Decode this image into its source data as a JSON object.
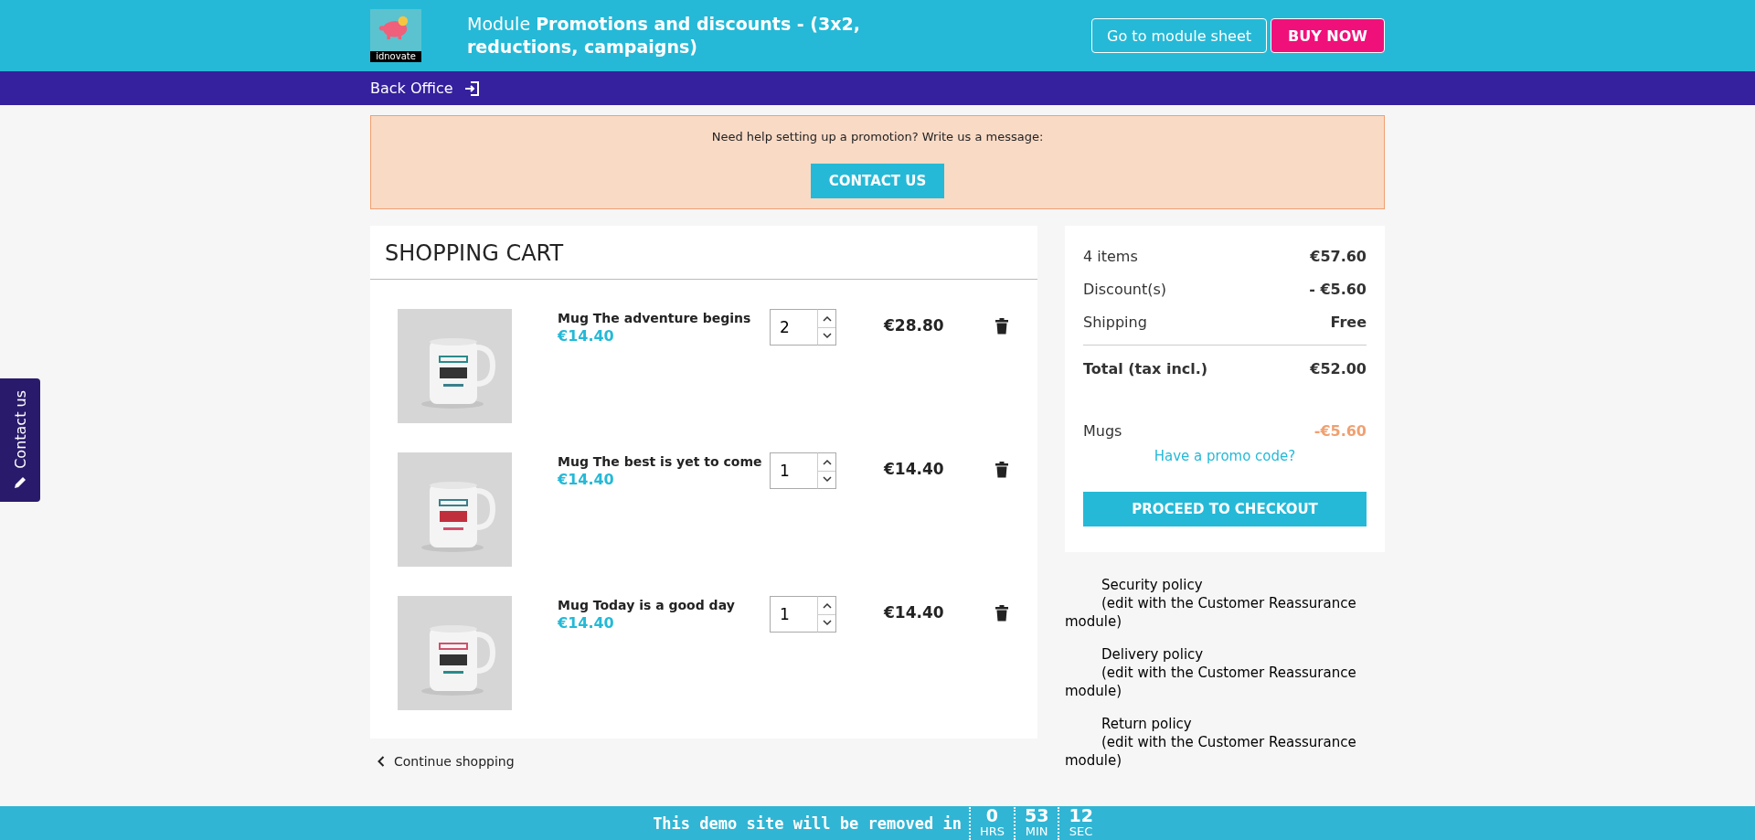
{
  "header": {
    "logo_text": "idnovate",
    "title": "Module **Promotions and discounts - (3x2, reductions, campaigns)**",
    "buttons": [
      {
        "label": "Go to module sheet",
        "kind": "outline"
      },
      {
        "label": "BUY NOW",
        "kind": "primary"
      }
    ]
  },
  "nav": {
    "link": "Back Office"
  },
  "help": {
    "text": "Need help setting up a promotion? Write us a message:",
    "button": "CONTACT US"
  },
  "cart": {
    "title": "SHOPPING CART",
    "items": [
      {
        "name": "Mug The adventure begins",
        "unit_price": "€14.40",
        "quantity": "2",
        "total": "€28.80"
      },
      {
        "name": "Mug The best is yet to come",
        "unit_price": "€14.40",
        "quantity": "1",
        "total": "€14.40"
      },
      {
        "name": "Mug Today is a good day",
        "unit_price": "€14.40",
        "quantity": "1",
        "total": "€14.40"
      }
    ],
    "continue": "Continue shopping"
  },
  "summary": {
    "lines": [
      {
        "label": "4 items",
        "value": "€57.60",
        "kind": "normal"
      },
      {
        "label": "Discount(s)",
        "value": "- €5.60",
        "kind": "normal"
      },
      {
        "label": "Shipping",
        "value": "Free",
        "kind": "normal"
      },
      {
        "label": "Total (tax incl.)",
        "value": "€52.00",
        "kind": "total"
      }
    ],
    "vouchers": [
      {
        "label": "Mugs",
        "value": "-€5.60"
      }
    ],
    "promo_link": "Have a promo code?",
    "checkout": "PROCEED TO CHECKOUT"
  },
  "reassurance": [
    {
      "title": "Security policy",
      "note": "(edit with the Customer Reassurance module)"
    },
    {
      "title": "Delivery policy",
      "note": "(edit with the Customer Reassurance module)"
    },
    {
      "title": "Return policy",
      "note": "(edit with the Customer Reassurance module)"
    }
  ],
  "side_tab": "Contact us",
  "demo_bar": {
    "text": "This demo site will be removed in",
    "countdown": [
      {
        "value": "0",
        "unit": "HRS"
      },
      {
        "value": "53",
        "unit": "MIN"
      },
      {
        "value": "12",
        "unit": "SEC"
      }
    ]
  }
}
